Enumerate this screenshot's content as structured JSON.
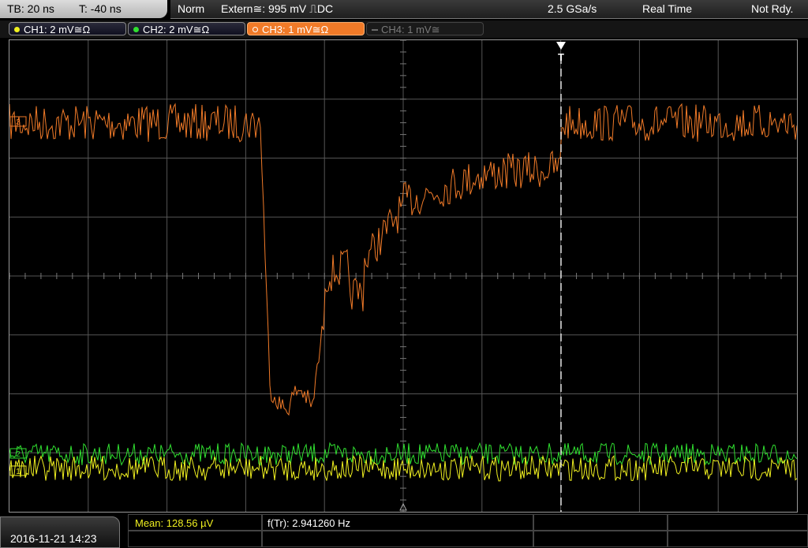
{
  "status_bar": {
    "timebase": "TB: 20 ns",
    "trigger_time": "T: -40 ns",
    "mode": "Norm",
    "trigger_source": "Extern≅: 995 mV ⎍DC",
    "sample_rate": "2.5 GSa/s",
    "acquisition": "Real Time",
    "run_state": "Not Rdy."
  },
  "channels": [
    {
      "label": "CH1: 2 mV≅Ω",
      "color": "#f0f020",
      "state": "on"
    },
    {
      "label": "CH2: 2 mV≅Ω",
      "color": "#30e030",
      "state": "on"
    },
    {
      "label": "CH3: 1 mV≅Ω",
      "color": "#f07a28",
      "state": "selected"
    },
    {
      "label": "CH4: 1 mV≅",
      "color": "#7a7a7a",
      "state": "off"
    }
  ],
  "trigger_marker": "T",
  "markers": {
    "ch1": "1",
    "ch2": "2",
    "ch3": "3"
  },
  "bottom": {
    "datetime": "2016-11-21 14:23",
    "meas_mean": "Mean: 128.56 µV",
    "meas_freq": "f(Tr): 2.941260 Hz"
  },
  "colors": {
    "ch1": "#f0f020",
    "ch2": "#30e030",
    "ch3": "#f07a28",
    "grid": "#555555"
  }
}
